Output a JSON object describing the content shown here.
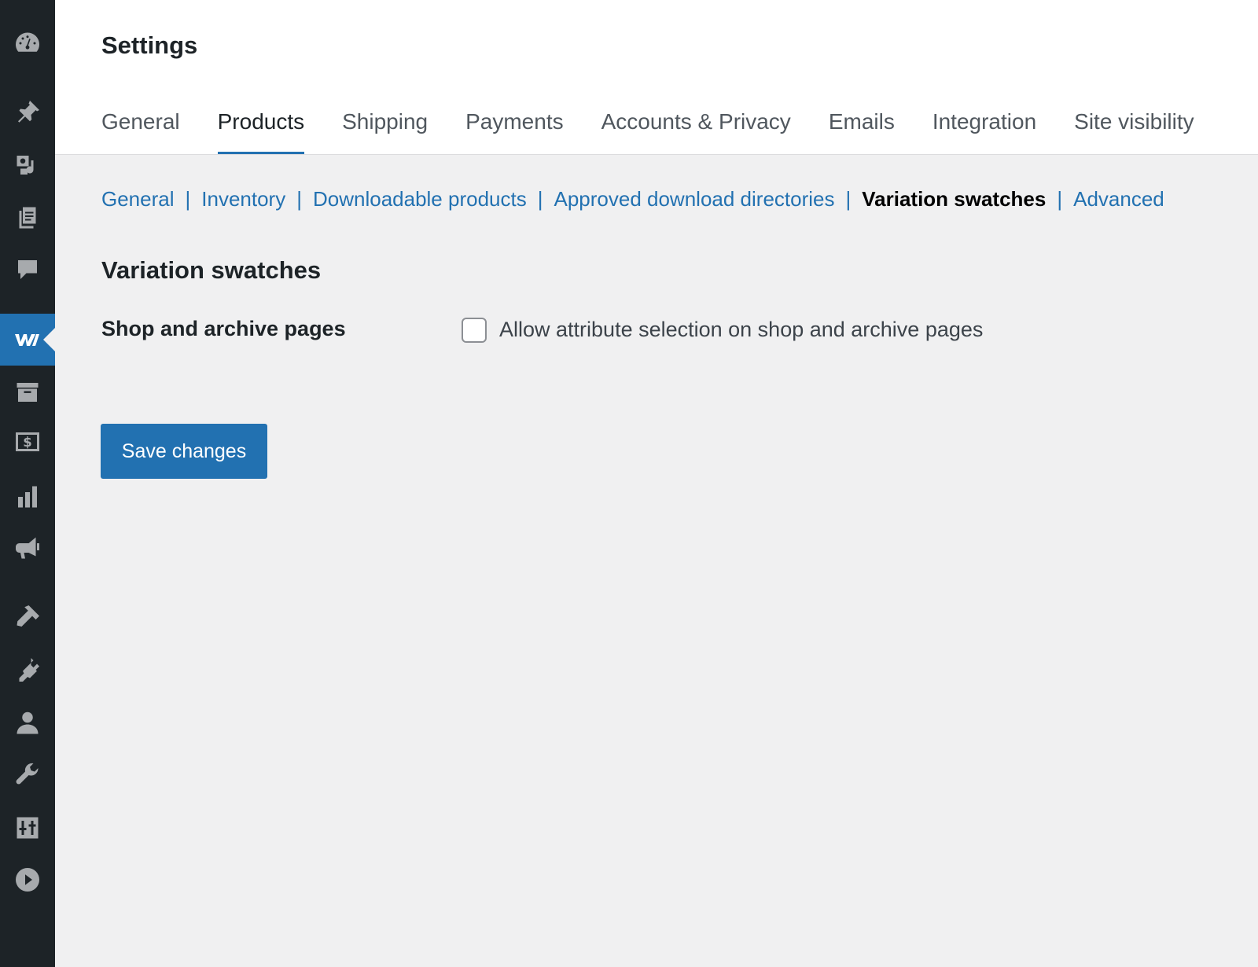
{
  "header": {
    "title": "Settings",
    "tabs": [
      {
        "label": "General"
      },
      {
        "label": "Products"
      },
      {
        "label": "Shipping"
      },
      {
        "label": "Payments"
      },
      {
        "label": "Accounts & Privacy"
      },
      {
        "label": "Emails"
      },
      {
        "label": "Integration"
      },
      {
        "label": "Site visibility"
      }
    ],
    "active_tab": "Products"
  },
  "subnav": {
    "items": [
      {
        "label": "General"
      },
      {
        "label": "Inventory"
      },
      {
        "label": "Downloadable products"
      },
      {
        "label": "Approved download directories"
      },
      {
        "label": "Variation swatches"
      },
      {
        "label": "Advanced"
      }
    ],
    "separator": "|",
    "current": "Variation swatches"
  },
  "section": {
    "title": "Variation swatches",
    "field_label": "Shop and archive pages",
    "checkbox_label": "Allow attribute selection on shop and archive pages",
    "checked": false
  },
  "actions": {
    "save_label": "Save changes"
  },
  "sidebar": {
    "icons": [
      "dashboard-icon",
      "pin-icon",
      "media-icon",
      "pages-icon",
      "comments-icon",
      "woocommerce-icon",
      "products-icon",
      "payments-icon",
      "analytics-icon",
      "marketing-icon",
      "appearance-icon",
      "plugins-icon",
      "users-icon",
      "tools-icon",
      "settings-icon",
      "play-icon"
    ]
  },
  "colors": {
    "sidebar_bg": "#1d2327",
    "accent": "#2271b1",
    "page_bg": "#f0f0f1",
    "icon": "#a7aaad"
  }
}
